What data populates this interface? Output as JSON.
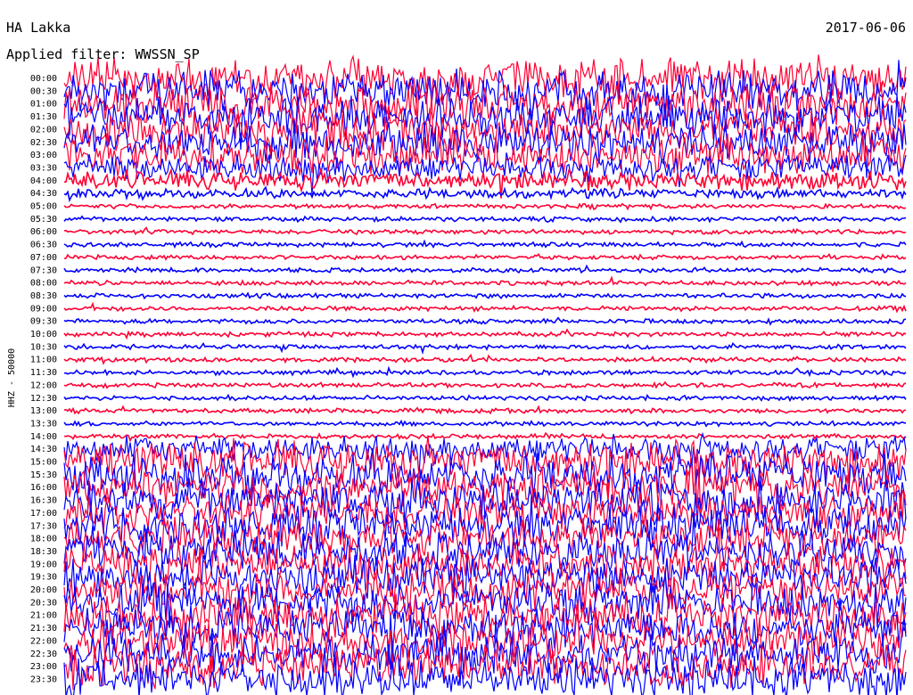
{
  "header": {
    "station": "HA Lakka",
    "date": "2017-06-06",
    "filter": "Applied filter: WWSSN_SP"
  },
  "colors": {
    "trace_a": "#0000ff",
    "trace_b": "#ff0033",
    "background": "#ffffff",
    "text": "#000000"
  },
  "chart_data": {
    "type": "line",
    "title": "HA Lakka",
    "subtitle": "Applied filter: WWSSN_SP",
    "ylabel": "HHZ - 50000",
    "y_tick_labels": [
      "00:00",
      "00:30",
      "01:00",
      "01:30",
      "02:00",
      "02:30",
      "03:00",
      "03:30",
      "04:00",
      "04:30",
      "05:00",
      "05:30",
      "06:00",
      "06:30",
      "07:00",
      "07:30",
      "08:00",
      "08:30",
      "09:00",
      "09:30",
      "10:00",
      "10:30",
      "11:00",
      "11:30",
      "12:00",
      "12:30",
      "13:00",
      "13:30",
      "14:00",
      "14:30",
      "15:00",
      "15:30",
      "16:00",
      "16:30",
      "17:00",
      "17:30",
      "18:00",
      "18:30",
      "19:00",
      "19:30",
      "20:00",
      "20:30",
      "21:00",
      "21:30",
      "22:00",
      "22:30",
      "23:00",
      "23:30"
    ],
    "row_noise_level": [
      5,
      5,
      5,
      5,
      5,
      5,
      5,
      4,
      3,
      2,
      1,
      1,
      1,
      1,
      1,
      1,
      1,
      1,
      1,
      1,
      1,
      1,
      1,
      1,
      1,
      1,
      1,
      1,
      1,
      4,
      5,
      5,
      5,
      5,
      5,
      5,
      5,
      5,
      5,
      5,
      5,
      5,
      5,
      5,
      5,
      5,
      5,
      5
    ],
    "row_colors": [
      "trace_b",
      "trace_a"
    ],
    "grid": false,
    "legend": "none"
  }
}
